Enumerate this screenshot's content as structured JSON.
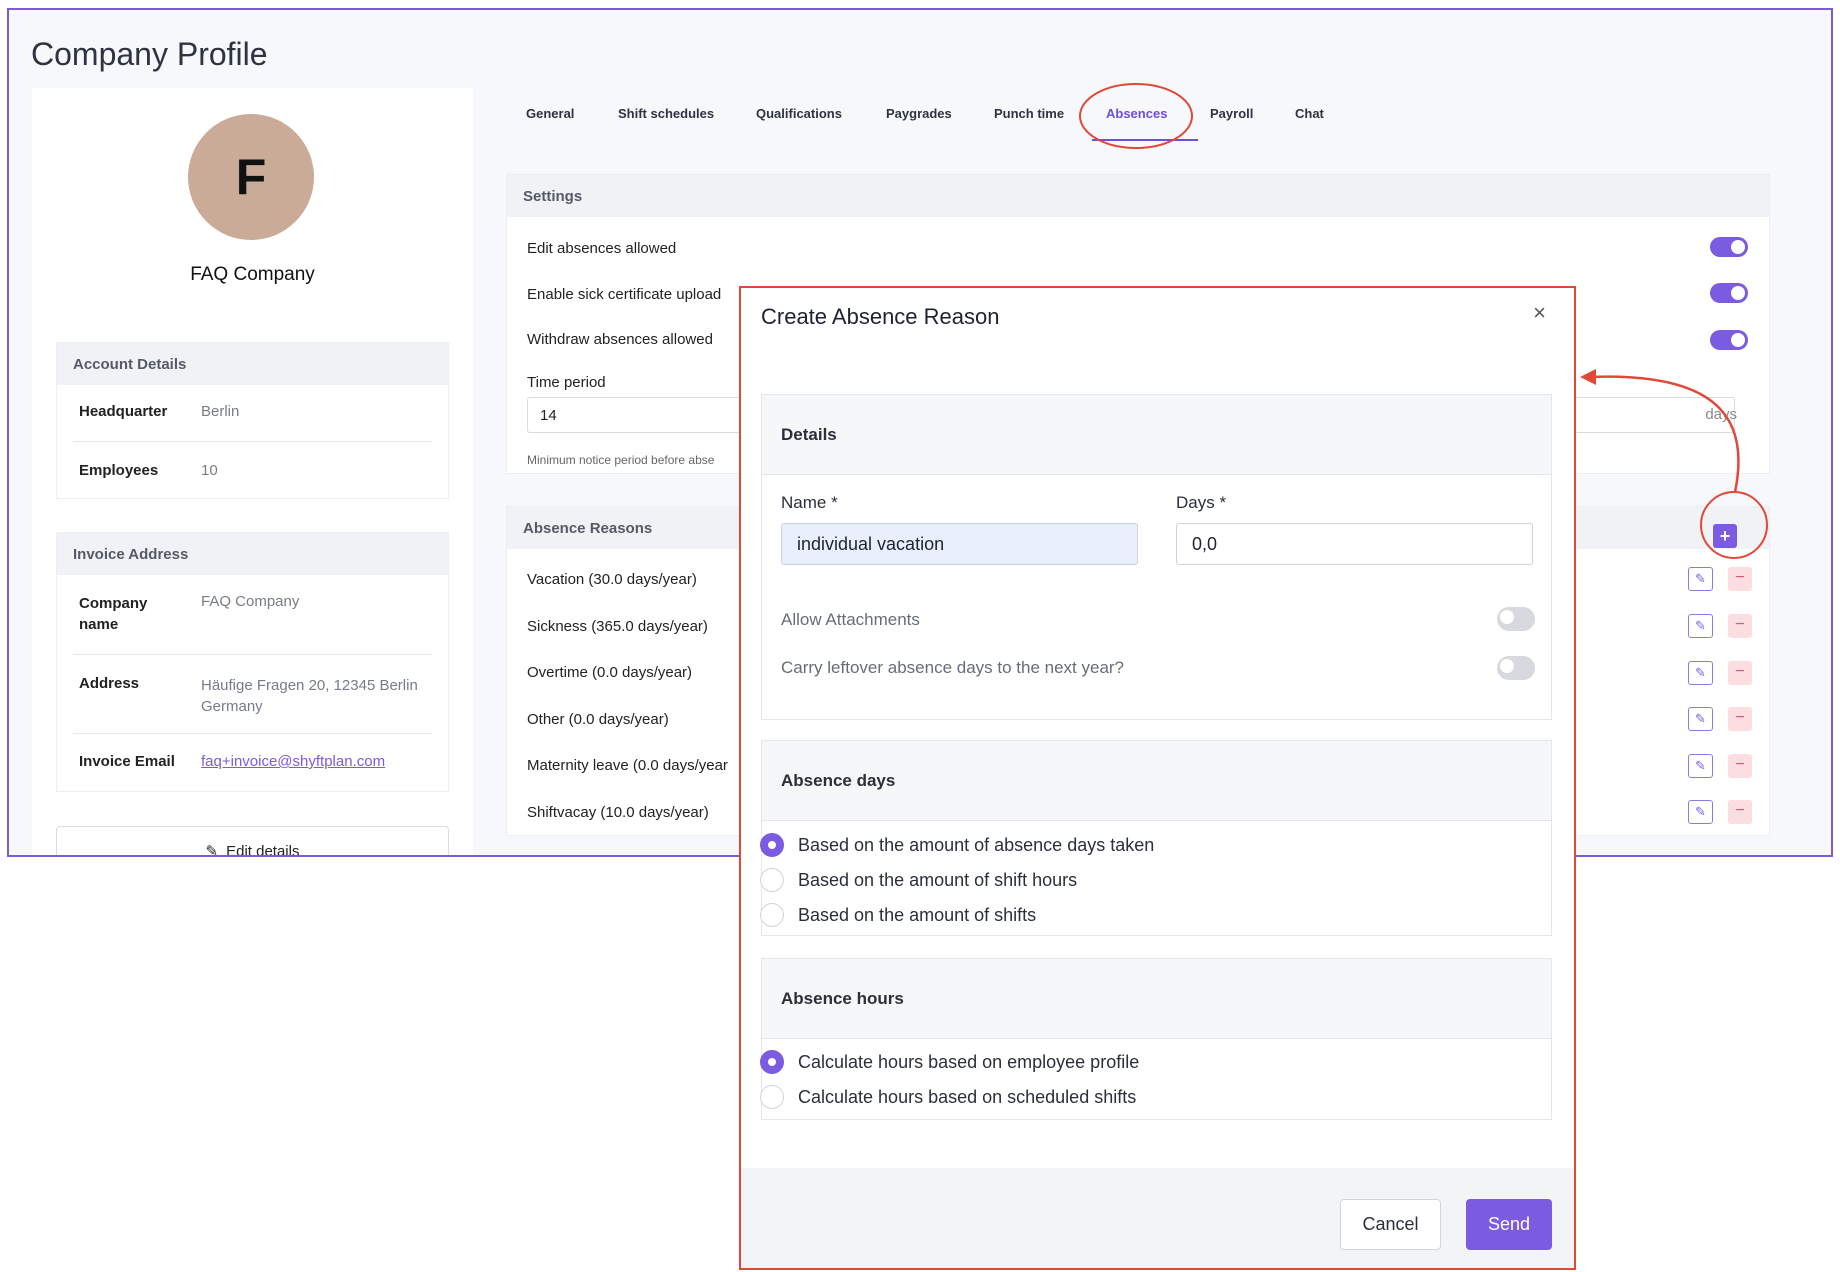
{
  "page": {
    "title": "Company Profile"
  },
  "company": {
    "initial": "F",
    "name": "FAQ Company"
  },
  "account_details": {
    "heading": "Account Details",
    "rows": [
      {
        "key": "Headquarter",
        "value": "Berlin"
      },
      {
        "key": "Employees",
        "value": "10"
      }
    ]
  },
  "invoice_address": {
    "heading": "Invoice Address",
    "company_name_key_1": "Company",
    "company_name_key_2": "name",
    "company_name_value": "FAQ Company",
    "address_key": "Address",
    "address_line_1": "Häufige Fragen 20, 12345 Berlin",
    "address_line_2": "Germany",
    "email_key": "Invoice Email",
    "email_value": "faq+invoice@shyftplan.com"
  },
  "edit_details_label": "Edit details",
  "tabs": [
    "General",
    "Shift schedules",
    "Qualifications",
    "Paygrades",
    "Punch time",
    "Absences",
    "Payroll",
    "Chat"
  ],
  "active_tab": "Absences",
  "settings": {
    "heading": "Settings",
    "edit_absences": "Edit absences allowed",
    "sick_certificate": "Enable sick certificate upload",
    "withdraw_absences": "Withdraw absences allowed",
    "time_period_label": "Time period",
    "time_period_value": "14",
    "time_period_suffix": "days",
    "notice_text": "Minimum notice period before abse"
  },
  "absence_reasons": {
    "heading": "Absence Reasons",
    "items": [
      "Vacation (30.0 days/year)",
      "Sickness (365.0 days/year)",
      "Overtime (0.0 days/year)",
      "Other (0.0 days/year)",
      "Maternity leave (0.0 days/year",
      "Shiftvacay (10.0 days/year)"
    ]
  },
  "modal": {
    "title": "Create Absence Reason",
    "close": "×",
    "details_heading": "Details",
    "name_label": "Name *",
    "name_value": "individual vacation",
    "days_label": "Days *",
    "days_value": "0,0",
    "allow_attachments": "Allow Attachments",
    "carry_leftover": "Carry leftover absence days to the next year?",
    "absence_days_heading": "Absence days",
    "absence_days_options": [
      "Based on the amount of absence days taken",
      "Based on the amount of shift hours",
      "Based on the amount of shifts"
    ],
    "absence_days_selected": 0,
    "absence_hours_heading": "Absence hours",
    "absence_hours_options": [
      "Calculate hours based on employee profile",
      "Calculate hours based on scheduled shifts"
    ],
    "absence_hours_selected": 0,
    "cancel_label": "Cancel",
    "send_label": "Send"
  },
  "colors": {
    "accent": "#7b5be0",
    "annotation": "#e0483a",
    "frame": "#7c5cd6"
  }
}
